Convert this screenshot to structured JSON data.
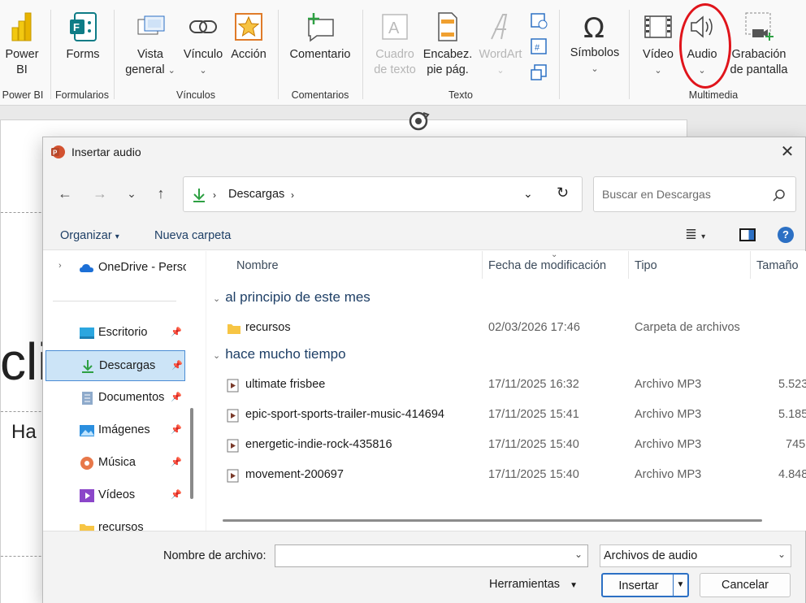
{
  "ribbon": {
    "powerbi": {
      "label1": "Power",
      "label2": "BI"
    },
    "forms": {
      "label": "Forms"
    },
    "vista": {
      "label1": "Vista",
      "label2": "general"
    },
    "vinculo": {
      "label": "Vínculo"
    },
    "accion": {
      "label": "Acción"
    },
    "comentario": {
      "label": "Comentario"
    },
    "cuadro": {
      "label1": "Cuadro",
      "label2": "de texto"
    },
    "encabez": {
      "label1": "Encabez.",
      "label2": "pie pág."
    },
    "wordart": {
      "label": "WordArt"
    },
    "simbolos": {
      "label": "Símbolos"
    },
    "video": {
      "label": "Vídeo"
    },
    "audio": {
      "label": "Audio"
    },
    "grabacion": {
      "label1": "Grabación",
      "label2": "de pantalla"
    },
    "groups": {
      "powerbi": "Power BI",
      "formularios": "Formularios",
      "vinculos": "Vínculos",
      "comentarios": "Comentarios",
      "texto": "Texto",
      "multimedia": "Multimedia"
    }
  },
  "slide": {
    "big_text": "clic",
    "small_text": "Ha"
  },
  "dialog": {
    "title": "Insertar audio",
    "close": "✕",
    "address": {
      "location": "Descargas"
    },
    "search_placeholder": "Buscar en Descargas",
    "commands": {
      "organize": "Organizar",
      "new_folder": "Nueva carpeta"
    },
    "nav": [
      {
        "label": "OneDrive - Personal",
        "pinned": false
      },
      {
        "label": "Escritorio",
        "pinned": true
      },
      {
        "label": "Descargas",
        "pinned": true,
        "selected": true
      },
      {
        "label": "Documentos",
        "pinned": true
      },
      {
        "label": "Imágenes",
        "pinned": true
      },
      {
        "label": "Música",
        "pinned": true
      },
      {
        "label": "Vídeos",
        "pinned": true
      },
      {
        "label": "recursos",
        "pinned": false
      }
    ],
    "columns": {
      "name": "Nombre",
      "date": "Fecha de modificación",
      "type": "Tipo",
      "size": "Tamaño"
    },
    "groups": [
      {
        "label": "al principio de este mes"
      },
      {
        "label": "hace mucho tiempo"
      }
    ],
    "files": [
      {
        "name": "recursos",
        "date": "02/03/2026 17:46",
        "type": "Carpeta de archivos",
        "size": ""
      },
      {
        "name": "ultimate frisbee",
        "date": "17/11/2025 16:32",
        "type": "Archivo MP3",
        "size": "5.523"
      },
      {
        "name": "epic-sport-sports-trailer-music-414694",
        "date": "17/11/2025 15:41",
        "type": "Archivo MP3",
        "size": "5.185"
      },
      {
        "name": "energetic-indie-rock-435816",
        "date": "17/11/2025 15:40",
        "type": "Archivo MP3",
        "size": "745"
      },
      {
        "name": "movement-200697",
        "date": "17/11/2025 15:40",
        "type": "Archivo MP3",
        "size": "4.848"
      }
    ],
    "filename_label": "Nombre de archivo:",
    "filename_value": "",
    "filetype": "Archivos de audio",
    "tools": "Herramientas",
    "insert": "Insertar",
    "cancel": "Cancelar"
  },
  "colors": {
    "highlight": "#e0141b",
    "accent": "#2c70c4",
    "link": "#1e3f66"
  }
}
